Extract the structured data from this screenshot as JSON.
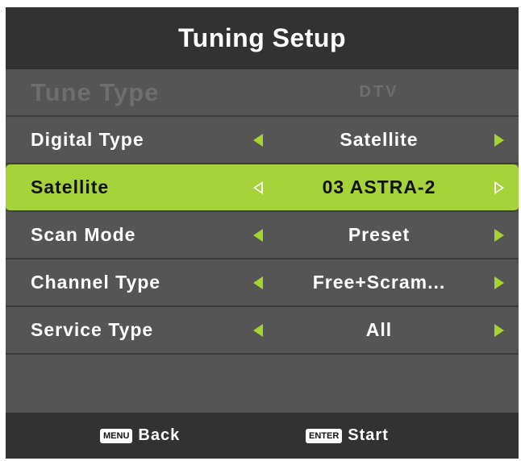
{
  "title": "Tuning Setup",
  "rows": [
    {
      "label": "Tune Type",
      "value": "DTV"
    },
    {
      "label": "Digital Type",
      "value": "Satellite"
    },
    {
      "label": "Satellite",
      "value": "03 ASTRA-2"
    },
    {
      "label": "Scan Mode",
      "value": "Preset"
    },
    {
      "label": "Channel Type",
      "value": "Free+Scram..."
    },
    {
      "label": "Service Type",
      "value": "All"
    }
  ],
  "footer": {
    "back_key": "MENU",
    "back_label": "Back",
    "start_key": "ENTER",
    "start_label": "Start"
  },
  "colors": {
    "accent": "#a6d23a",
    "panel": "#555555",
    "bar": "#323232"
  },
  "icons": {
    "left": "triangle-left-icon",
    "right": "triangle-right-icon"
  }
}
